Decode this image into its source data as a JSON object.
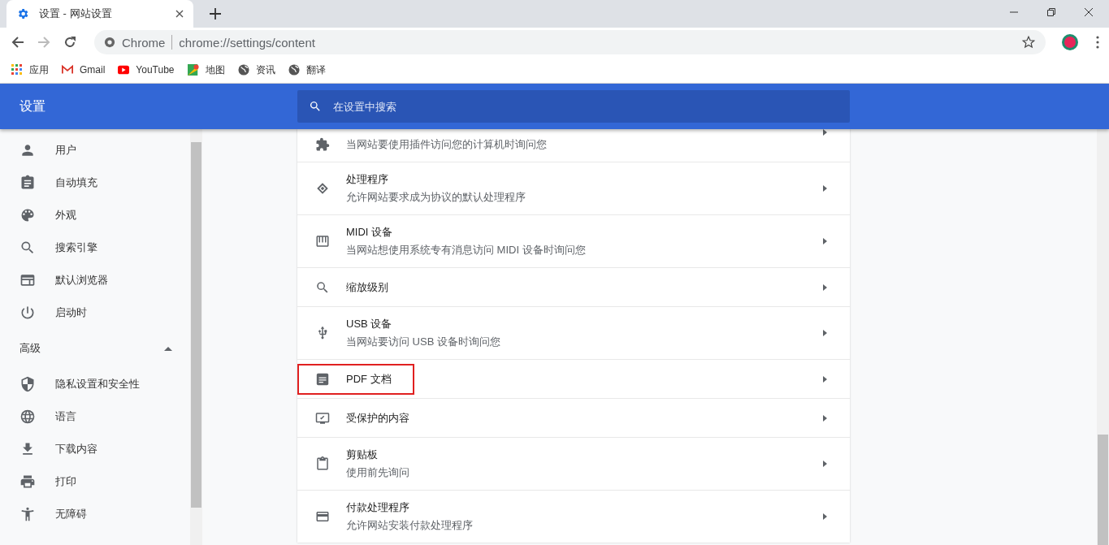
{
  "tab": {
    "title": "设置 - 网站设置",
    "selected": true
  },
  "address_bar": {
    "site_label": "Chrome",
    "url": "chrome://settings/content"
  },
  "bookmarks": [
    {
      "label": "应用"
    },
    {
      "label": "Gmail"
    },
    {
      "label": "YouTube"
    },
    {
      "label": "地图"
    },
    {
      "label": "资讯"
    },
    {
      "label": "翻译"
    }
  ],
  "header": {
    "title": "设置",
    "search_placeholder": "在设置中搜索"
  },
  "sidebar": {
    "items": [
      {
        "label": "用户"
      },
      {
        "label": "自动填充"
      },
      {
        "label": "外观"
      },
      {
        "label": "搜索引擎"
      },
      {
        "label": "默认浏览器"
      },
      {
        "label": "启动时"
      }
    ],
    "section": {
      "label": "高级",
      "expanded": true
    },
    "advanced_items": [
      {
        "label": "隐私设置和安全性"
      },
      {
        "label": "语言"
      },
      {
        "label": "下载内容"
      },
      {
        "label": "打印"
      },
      {
        "label": "无障碍"
      }
    ]
  },
  "content_rows": [
    {
      "description": "当网站要使用插件访问您的计算机时询问您",
      "highlighted": false
    },
    {
      "title": "处理程序",
      "description": "允许网站要求成为协议的默认处理程序",
      "highlighted": false
    },
    {
      "title": "MIDI 设备",
      "description": "当网站想使用系统专有消息访问 MIDI 设备时询问您",
      "highlighted": false
    },
    {
      "title": "缩放级别",
      "highlighted": false
    },
    {
      "title": "USB 设备",
      "description": "当网站要访问 USB 设备时询问您",
      "highlighted": false
    },
    {
      "title": "PDF 文档",
      "highlighted": true
    },
    {
      "title": "受保护的内容",
      "highlighted": false
    },
    {
      "title": "剪贴板",
      "description": "使用前先询问",
      "highlighted": false
    },
    {
      "title": "付款处理程序",
      "description": "允许网站安装付款处理程序",
      "highlighted": false
    }
  ]
}
